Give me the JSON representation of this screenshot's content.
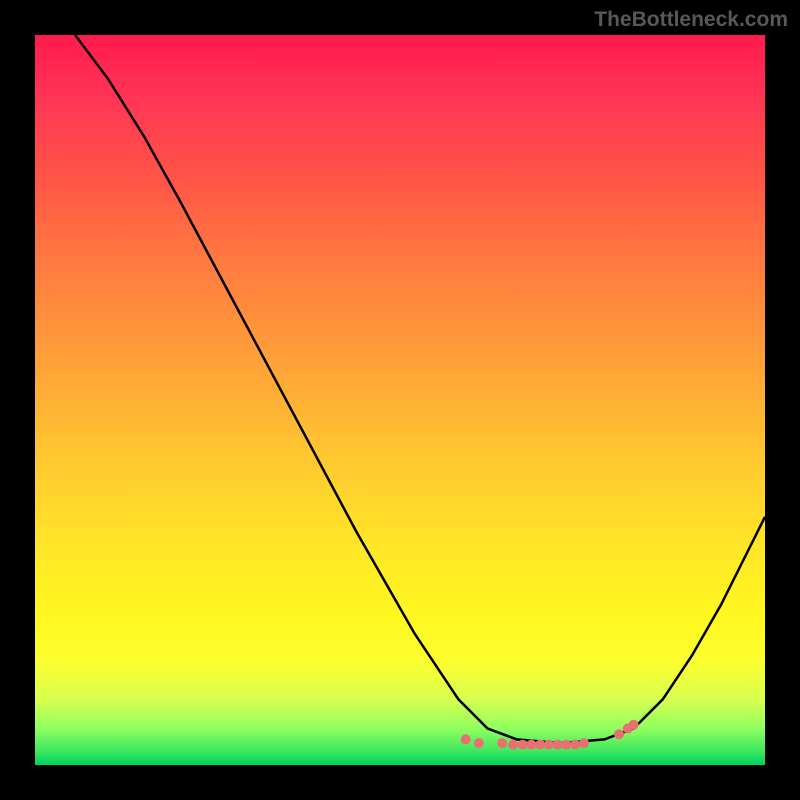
{
  "watermark": "TheBottleneck.com",
  "chart_data": {
    "type": "line",
    "title": "",
    "xlabel": "",
    "ylabel": "",
    "xlim": [
      0,
      1
    ],
    "ylim": [
      0,
      1
    ],
    "background_gradient": {
      "top": "#ff1a4d",
      "middle": "#ffe628",
      "bottom": "#00d060"
    },
    "series": [
      {
        "name": "curve",
        "stroke": "#000000",
        "x": [
          0.055,
          0.1,
          0.15,
          0.2,
          0.28,
          0.36,
          0.44,
          0.52,
          0.58,
          0.62,
          0.66,
          0.72,
          0.78,
          0.82,
          0.86,
          0.9,
          0.94,
          0.98,
          1.0
        ],
        "y": [
          1.0,
          0.94,
          0.86,
          0.77,
          0.62,
          0.47,
          0.32,
          0.18,
          0.09,
          0.05,
          0.035,
          0.03,
          0.035,
          0.05,
          0.09,
          0.15,
          0.22,
          0.3,
          0.34
        ]
      },
      {
        "name": "marker-dots",
        "stroke": "#e87070",
        "points": [
          {
            "x": 0.59,
            "y": 0.965
          },
          {
            "x": 0.608,
            "y": 0.97
          },
          {
            "x": 0.64,
            "y": 0.97
          },
          {
            "x": 0.655,
            "y": 0.972
          },
          {
            "x": 0.668,
            "y": 0.972
          },
          {
            "x": 0.68,
            "y": 0.972
          },
          {
            "x": 0.692,
            "y": 0.972
          },
          {
            "x": 0.704,
            "y": 0.972
          },
          {
            "x": 0.716,
            "y": 0.972
          },
          {
            "x": 0.728,
            "y": 0.972
          },
          {
            "x": 0.74,
            "y": 0.972
          },
          {
            "x": 0.752,
            "y": 0.97
          },
          {
            "x": 0.8,
            "y": 0.958
          },
          {
            "x": 0.812,
            "y": 0.95
          },
          {
            "x": 0.82,
            "y": 0.945
          }
        ]
      }
    ]
  }
}
